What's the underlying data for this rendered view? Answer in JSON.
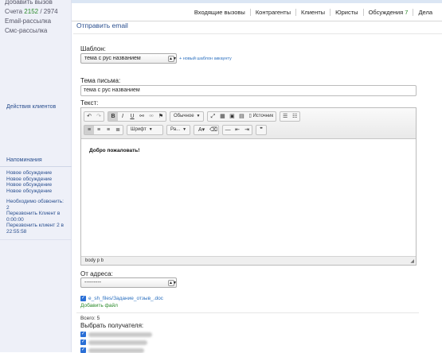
{
  "sidebar": {
    "add_call": "Добавить вызов",
    "accounts_label": "Счета",
    "accounts_current": "2152",
    "accounts_separator": "/",
    "accounts_total": "2974",
    "email_mailing": "Email-рассылка",
    "sms_mailing": "Смс-рассылка",
    "client_actions": "Действия клиентов",
    "reminders_title": "Напоминания",
    "reminders": [
      "Новое обсуждение",
      "Новое обсуждение",
      "Новое обсуждение",
      "Новое обсуждение"
    ],
    "need_call": "Необходимо обзвонить: 2",
    "callbacks": [
      {
        "line1": "Перезвонить Клиент в",
        "line2": "0:00:00"
      },
      {
        "line1": "Перезвонить клиент 2 в",
        "line2": "22:55:58"
      }
    ]
  },
  "nav": {
    "tabs": [
      {
        "label": "Входящие вызовы"
      },
      {
        "label": "Контрагенты"
      },
      {
        "label": "Клиенты"
      },
      {
        "label": "Юристы"
      },
      {
        "label": "Обсуждения",
        "badge": "7"
      },
      {
        "label": "Дела"
      }
    ]
  },
  "page_title": "Отправить email",
  "form": {
    "template_label": "Шаблон:",
    "template_value": "тема с рус названием",
    "new_template_link": "+ новый шаблон аккаунту",
    "subject_label": "Тема письма:",
    "subject_value": "тема с рус названием",
    "text_label": "Текст:",
    "editor": {
      "format_combo": "Обычное",
      "source_label": "Источник",
      "font_combo": "Шрифт",
      "size_combo": "Ра...",
      "content": "Добро пожаловать!",
      "status_path": "body  p  b"
    },
    "from_label": "От адреса:",
    "from_value": "---------",
    "attached_file": "e_sh_files/Задание_отзыв_.doc",
    "add_file": "Добавить файл",
    "total": "Всего: 5",
    "choose_recipients": "Выбрать получателя:"
  },
  "colors": {
    "link": "#2a4f8f",
    "green": "#2a8a2a",
    "red": "#cc2222",
    "checkbox": "#2a6fd6"
  }
}
